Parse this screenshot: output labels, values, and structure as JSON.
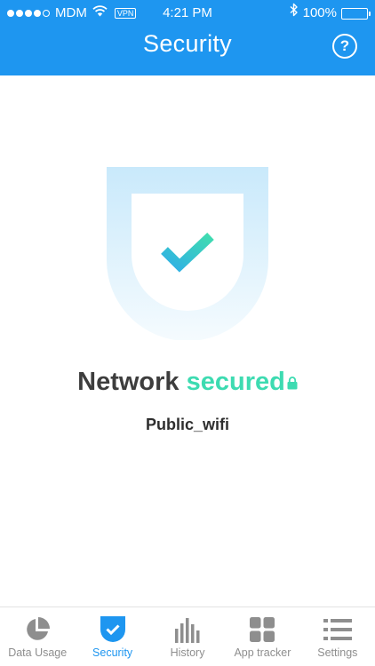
{
  "status_bar": {
    "carrier": "MDM",
    "vpn": "VPN",
    "time": "4:21 PM",
    "battery": "100%"
  },
  "header": {
    "title": "Security",
    "help_label": "?"
  },
  "main": {
    "status_prefix": "Network",
    "status_word": "secured",
    "network_name": "Public_wifi"
  },
  "tabs": [
    {
      "label": "Data Usage",
      "icon": "pie-chart-icon"
    },
    {
      "label": "Security",
      "icon": "shield-check-icon"
    },
    {
      "label": "History",
      "icon": "bar-chart-icon"
    },
    {
      "label": "App tracker",
      "icon": "grid-icon"
    },
    {
      "label": "Settings",
      "icon": "list-icon"
    }
  ],
  "colors": {
    "accent": "#1e96f0",
    "secured": "#3ddbb1",
    "inactive_tab": "#8e8e8e"
  }
}
